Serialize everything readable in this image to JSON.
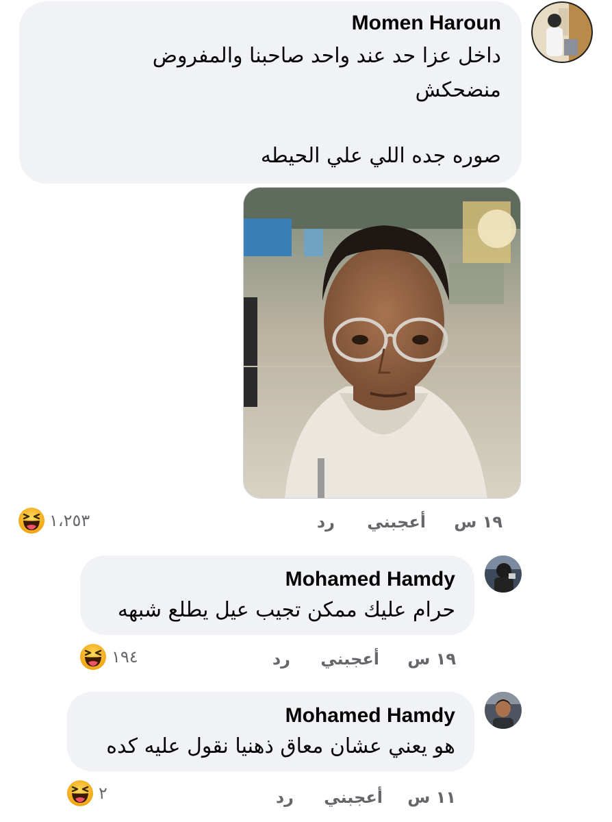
{
  "comments": [
    {
      "author": "Momen Haroun",
      "lines": [
        "داخل عزا حد عند واحد صاحبنا والمفروض",
        "منضحكش",
        "صوره جده اللي علي الحيطه"
      ],
      "time": "١٩ س",
      "like_label": "أعجبني",
      "reply_label": "رد",
      "reaction_count": "١،٢٥٣",
      "reaction": "haha-icon"
    },
    {
      "author": "Mohamed Hamdy",
      "lines": [
        "حرام عليك ممكن تجيب عيل يطلع شبهه"
      ],
      "time": "١٩ س",
      "like_label": "أعجبني",
      "reply_label": "رد",
      "reaction_count": "١٩٤",
      "reaction": "haha-icon"
    },
    {
      "author": "Mohamed Hamdy",
      "lines": [
        "هو يعني عشان معاق ذهنيا نقول عليه كده"
      ],
      "time": "١١ س",
      "like_label": "أعجبني",
      "reply_label": "رد",
      "reaction_count": "٢",
      "reaction": "haha-icon"
    }
  ],
  "colors": {
    "bubble": "#f0f2f5",
    "secondary_text": "#65676b",
    "haha_yellow": "#f7b125"
  }
}
